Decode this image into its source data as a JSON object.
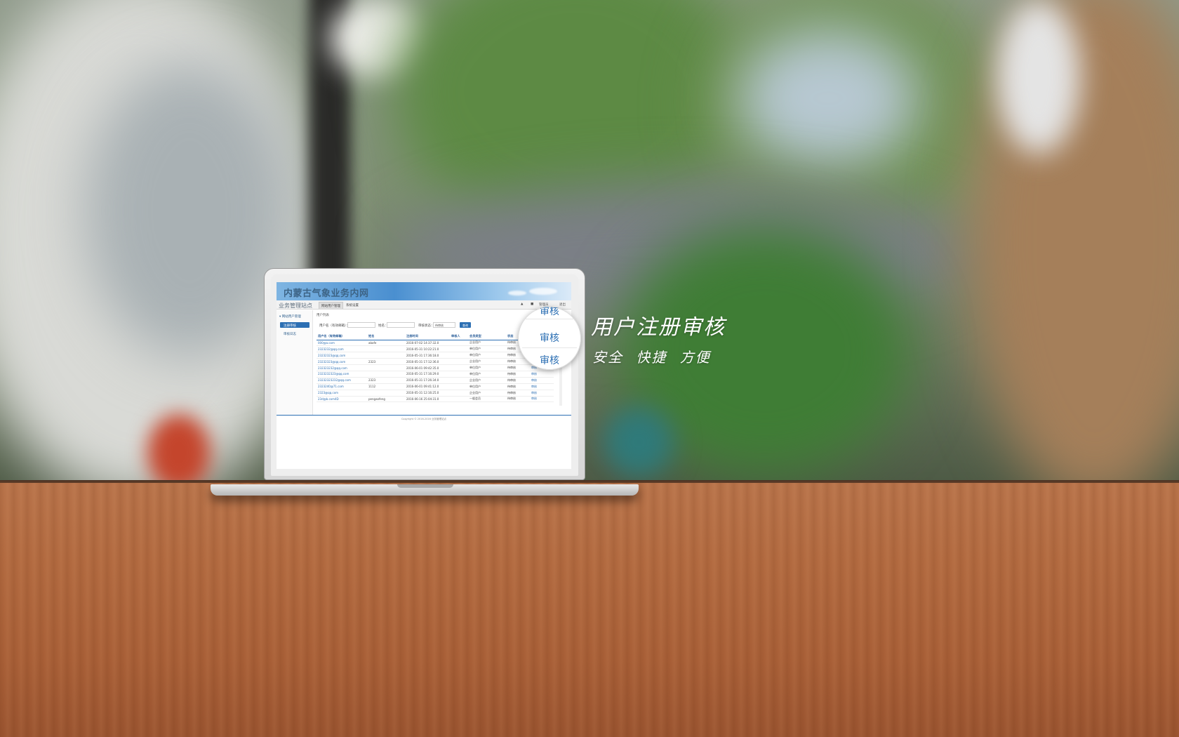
{
  "hero": {
    "title": "用户注册审核",
    "subtitle": "安全  快捷  方便"
  },
  "magnifier": {
    "items": [
      "审核",
      "审核",
      "审核"
    ]
  },
  "app": {
    "title": "内蒙古气象业务内网",
    "site_name": "业务管理站点",
    "tabs": [
      "网站用户管理",
      "系统设置"
    ],
    "nav_right": [
      "▲",
      "■",
      "管理员",
      "退出"
    ],
    "sidebar": {
      "group": "▾ 网站用户管理",
      "active_item": "注册审核",
      "item": "审核日志"
    },
    "breadcrumb": "用户列表",
    "filter": {
      "username_label": "用户名（有效邮箱）：",
      "name_label": "姓名：",
      "status_label": "审核状态：",
      "status_value": "待审核",
      "search_button": "查询"
    },
    "table": {
      "headers": [
        "用户名（有效邮箱）",
        "姓名",
        "注册时间",
        "审核人",
        "会员类型",
        "状态",
        ""
      ],
      "rows": [
        [
          "000@a.com",
          "abafe",
          "2016-07-02 14:37:32.0",
          "",
          "企业用户",
          "待审核",
          "审核"
        ],
        [
          "2323232@qq.com",
          "",
          "2016-05-31 10:22:21.0",
          "",
          "单位用户",
          "待审核",
          "审核"
        ],
        [
          "23232323@qq.com",
          "",
          "2016-05-31 17:36:18.0",
          "",
          "单位用户",
          "待审核",
          "审核"
        ],
        [
          "23232323@qq.com",
          "2323",
          "2016-05-31 17:12:36.0",
          "",
          "企业用户",
          "待审核",
          "审核"
        ],
        [
          "232323232@qq.com",
          "",
          "2016-06-01 09:42:35.0",
          "",
          "单位用户",
          "待审核",
          "审核"
        ],
        [
          "2323232323@qq.com",
          "",
          "2016-05-31 17:16:29.0",
          "",
          "单位用户",
          "待审核",
          "审核"
        ],
        [
          "23232323232@qq.com",
          "2323",
          "2016-05-31 17:26:34.0",
          "",
          "企业用户",
          "待审核",
          "审核"
        ],
        [
          "2323240@71.com",
          "1112",
          "2016-06-01 09:41:12.0",
          "",
          "单位用户",
          "待审核",
          "审核"
        ],
        [
          "2323@qq.com",
          "",
          "2016-05-31 12:16:25.0",
          "",
          "企业用户",
          "待审核",
          "审核"
        ],
        [
          "23d@b.com4D",
          "pengaofeng",
          "2016-06-16 25:04:31.0",
          "",
          "一般会员",
          "待审核",
          "审核"
        ]
      ]
    },
    "footer": "Copyright © 2016-2016 业务管理站点"
  }
}
